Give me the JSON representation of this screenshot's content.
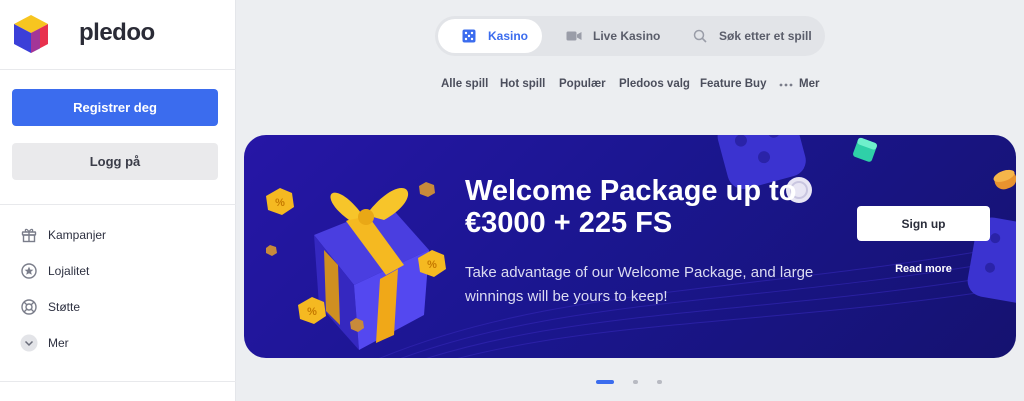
{
  "brand": {
    "name": "pledoo",
    "icon": "cube-logo-icon"
  },
  "sidebar": {
    "register_label": "Registrer deg",
    "login_label": "Logg på",
    "nav": [
      {
        "label": "Kampanjer",
        "icon": "gift-icon"
      },
      {
        "label": "Lojalitet",
        "icon": "star-icon"
      },
      {
        "label": "Støtte",
        "icon": "lifebuoy-icon"
      },
      {
        "label": "Mer",
        "icon": "chevron-down-icon"
      }
    ]
  },
  "topbar": {
    "tabs": [
      {
        "label": "Kasino",
        "icon": "dice-icon",
        "active": true
      },
      {
        "label": "Live Kasino",
        "icon": "video-camera-icon",
        "active": false
      }
    ],
    "search_label": "Søk etter et spill"
  },
  "categories": [
    "Alle spill",
    "Hot spill",
    "Populær",
    "Pledoos valg",
    "Feature Buy",
    "Mer"
  ],
  "banner": {
    "title": "Welcome Package up to €3000 + 225 FS",
    "description": "Take advantage of our Welcome Package, and large winnings will be yours to keep!",
    "signup_label": "Sign up",
    "readmore_label": "Read more"
  },
  "carousel": {
    "slides": 3,
    "active_index": 0
  },
  "colors": {
    "accent": "#3b6cee",
    "banner_bg": "#1b1690",
    "gift_ribbon": "#f5b921"
  }
}
